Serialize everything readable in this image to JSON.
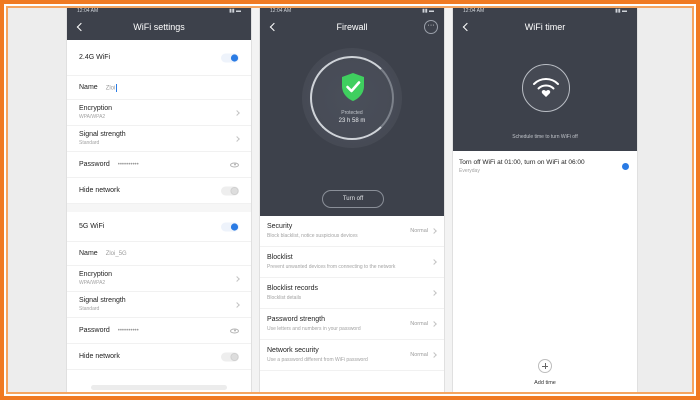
{
  "status_bar": {
    "time": "12:04 AM",
    "icons": "▮▮ ▬"
  },
  "wifi_settings": {
    "title": "WiFi settings",
    "band24": {
      "header": "2.4G WiFi",
      "name_label": "Name",
      "name_value": "Zloi",
      "encryption_label": "Encryption",
      "encryption_value": "WPA/WPA2",
      "signal_label": "Signal strength",
      "signal_value": "Standard",
      "password_label": "Password",
      "password_value": "••••••••••",
      "hide_label": "Hide network"
    },
    "band5": {
      "header": "5G WiFi",
      "name_label": "Name",
      "name_value": "Zloi_5G",
      "encryption_label": "Encryption",
      "encryption_value": "WPA/WPA2",
      "signal_label": "Signal strength",
      "signal_value": "Standard",
      "password_label": "Password",
      "password_value": "••••••••••",
      "hide_label": "Hide network"
    }
  },
  "firewall": {
    "title": "Firewall",
    "more": "···",
    "status": "Protected",
    "time": "23 h 58 m",
    "turn_off": "Turn off",
    "items": [
      {
        "title": "Security",
        "desc": "Block blacklist, notice suspicious devices",
        "status": "Normal"
      },
      {
        "title": "Blocklist",
        "desc": "Prevent unwanted devices from connecting to the network",
        "status": ""
      },
      {
        "title": "Blocklist records",
        "desc": "Blocklist details",
        "status": ""
      },
      {
        "title": "Password strength",
        "desc": "Use letters and numbers in your password",
        "status": "Normal"
      },
      {
        "title": "Network security",
        "desc": "Use a password different from WiFi password",
        "status": "Normal"
      }
    ]
  },
  "wifi_timer": {
    "title": "WiFi timer",
    "hint": "Schedule time to turn WiFi off",
    "schedule_title": "Torn off WiFi at 01:00, turn on WiFi at 06:00",
    "schedule_repeat": "Everyday",
    "add_label": "Add time"
  },
  "colors": {
    "accent": "#2a7be4",
    "header": "#3d414b",
    "frame": "#f07a22",
    "shield": "#3fcf5f"
  }
}
